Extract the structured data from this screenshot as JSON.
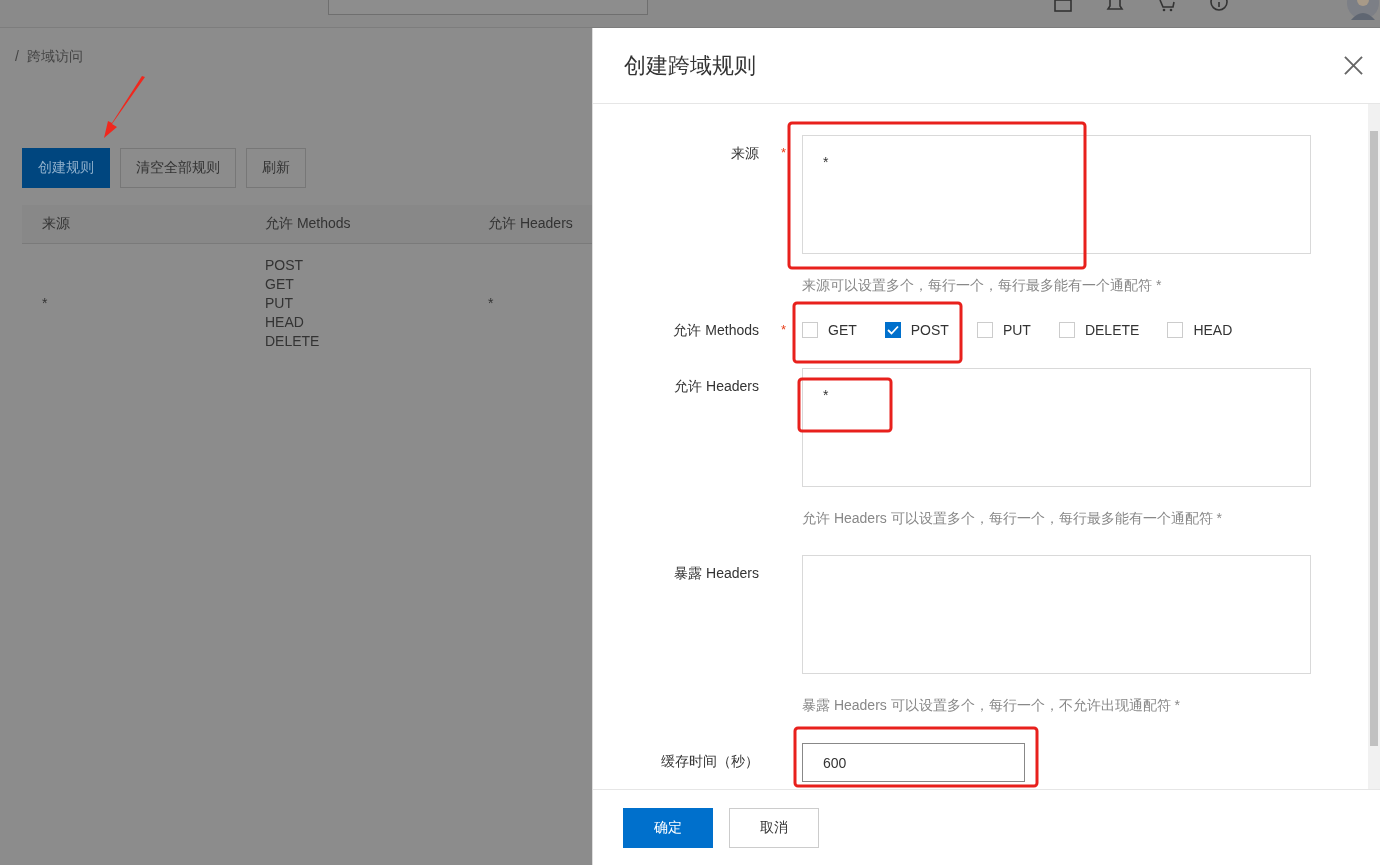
{
  "breadcrumb": {
    "separator": "/",
    "current": "跨域访问"
  },
  "toolbar": [
    {
      "label": "创建规则",
      "kind": "primary"
    },
    {
      "label": "清空全部规则",
      "kind": "default"
    },
    {
      "label": "刷新",
      "kind": "default"
    }
  ],
  "table": {
    "columns": [
      "来源",
      "允许 Methods",
      "允许 Headers"
    ],
    "rows": [
      {
        "cells": [
          [
            "*"
          ],
          [
            "POST",
            "GET",
            "PUT",
            "HEAD",
            "DELETE"
          ],
          [
            "*"
          ]
        ]
      }
    ]
  },
  "panel": {
    "title": "创建跨域规则",
    "fields": [
      {
        "kind": "textarea",
        "label": "来源",
        "required": true,
        "value": "*",
        "hint": "来源可以设置多个，每行一个，每行最多能有一个通配符 *"
      },
      {
        "kind": "checkboxes",
        "label": "允许 Methods",
        "required": true,
        "options": [
          {
            "label": "GET",
            "checked": false
          },
          {
            "label": "POST",
            "checked": true
          },
          {
            "label": "PUT",
            "checked": false
          },
          {
            "label": "DELETE",
            "checked": false
          },
          {
            "label": "HEAD",
            "checked": false
          }
        ]
      },
      {
        "kind": "textarea",
        "label": "允许 Headers",
        "required": false,
        "value": "*",
        "hint": "允许 Headers 可以设置多个，每行一个，每行最多能有一个通配符 *"
      },
      {
        "kind": "textarea",
        "label": "暴露 Headers",
        "required": false,
        "hint": "暴露 Headers 可以设置多个，每行一个，不允许出现通配符 *"
      },
      {
        "kind": "input",
        "label": "缓存时间（秒）",
        "required": false,
        "value": "600"
      }
    ],
    "buttons": [
      {
        "label": "确定",
        "kind": "primary"
      },
      {
        "label": "取消",
        "kind": "default"
      }
    ]
  }
}
